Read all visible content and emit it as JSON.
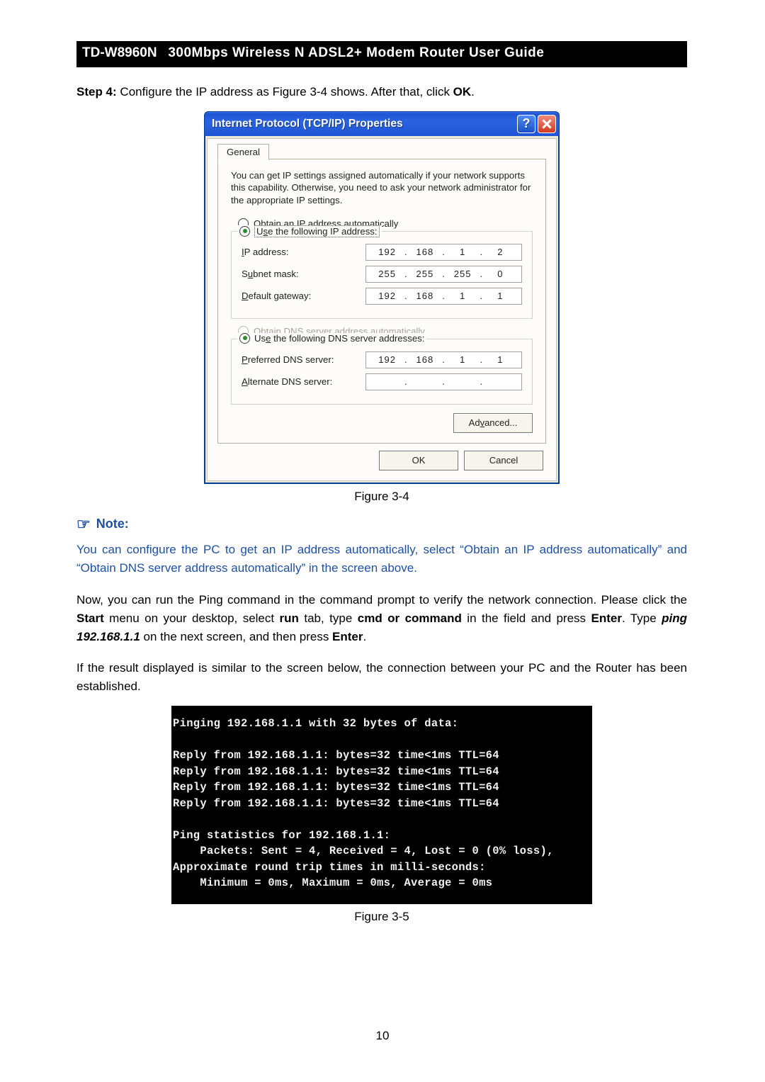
{
  "header": {
    "model": "TD-W8960N",
    "title": "300Mbps Wireless N ADSL2+ Modem Router User Guide"
  },
  "step4": {
    "prefix": "Step 4:",
    "text_a": "Configure the IP address as Figure 3-4 shows. After that, click ",
    "ok": "OK",
    "text_b": "."
  },
  "dialog": {
    "title": "Internet Protocol (TCP/IP) Properties",
    "tab": "General",
    "intro": "You can get IP settings assigned automatically if your network supports this capability. Otherwise, you need to ask your network administrator for the appropriate IP settings.",
    "ip": {
      "auto": "Obtain an IP address automatically",
      "use": "Use the following IP address:",
      "fields": {
        "ip_label": "IP address:",
        "ip_value": [
          "192",
          "168",
          "1",
          "2"
        ],
        "mask_label": "Subnet mask:",
        "mask_value": [
          "255",
          "255",
          "255",
          "0"
        ],
        "gw_label": "Default gateway:",
        "gw_value": [
          "192",
          "168",
          "1",
          "1"
        ]
      }
    },
    "dns": {
      "auto": "Obtain DNS server address automatically",
      "use": "Use the following DNS server addresses:",
      "pref_label": "Preferred DNS server:",
      "pref_value": [
        "192",
        "168",
        "1",
        "1"
      ],
      "alt_label": "Alternate DNS server:",
      "alt_value": [
        "",
        "",
        "",
        ""
      ]
    },
    "advanced": "Advanced...",
    "ok": "OK",
    "cancel": "Cancel"
  },
  "fig1": "Figure 3-4",
  "note": {
    "heading": "Note:",
    "body": "You can configure the PC to get an IP address automatically, select “Obtain an IP address automatically” and “Obtain DNS server address automatically” in the screen above."
  },
  "para1": {
    "a": "Now, you can run the Ping command in the command prompt to verify the network connection. Please click the ",
    "start": "Start",
    "b": " menu on your desktop, select ",
    "run": "run",
    "c": " tab, type ",
    "cmd": "cmd or command",
    "d": " in the field and press ",
    "enter1": "Enter",
    "e": ". Type ",
    "ping": "ping 192.168.1.1",
    "f": " on the next screen, and then press ",
    "enter2": "Enter",
    "g": "."
  },
  "para2": "If the result displayed is similar to the screen below, the connection between your PC and the Router has been established.",
  "cmd_output": "Pinging 192.168.1.1 with 32 bytes of data:\n\nReply from 192.168.1.1: bytes=32 time<1ms TTL=64\nReply from 192.168.1.1: bytes=32 time<1ms TTL=64\nReply from 192.168.1.1: bytes=32 time<1ms TTL=64\nReply from 192.168.1.1: bytes=32 time<1ms TTL=64\n\nPing statistics for 192.168.1.1:\n    Packets: Sent = 4, Received = 4, Lost = 0 (0% loss),\nApproximate round trip times in milli-seconds:\n    Minimum = 0ms, Maximum = 0ms, Average = 0ms",
  "fig2": "Figure 3-5",
  "page_number": "10"
}
